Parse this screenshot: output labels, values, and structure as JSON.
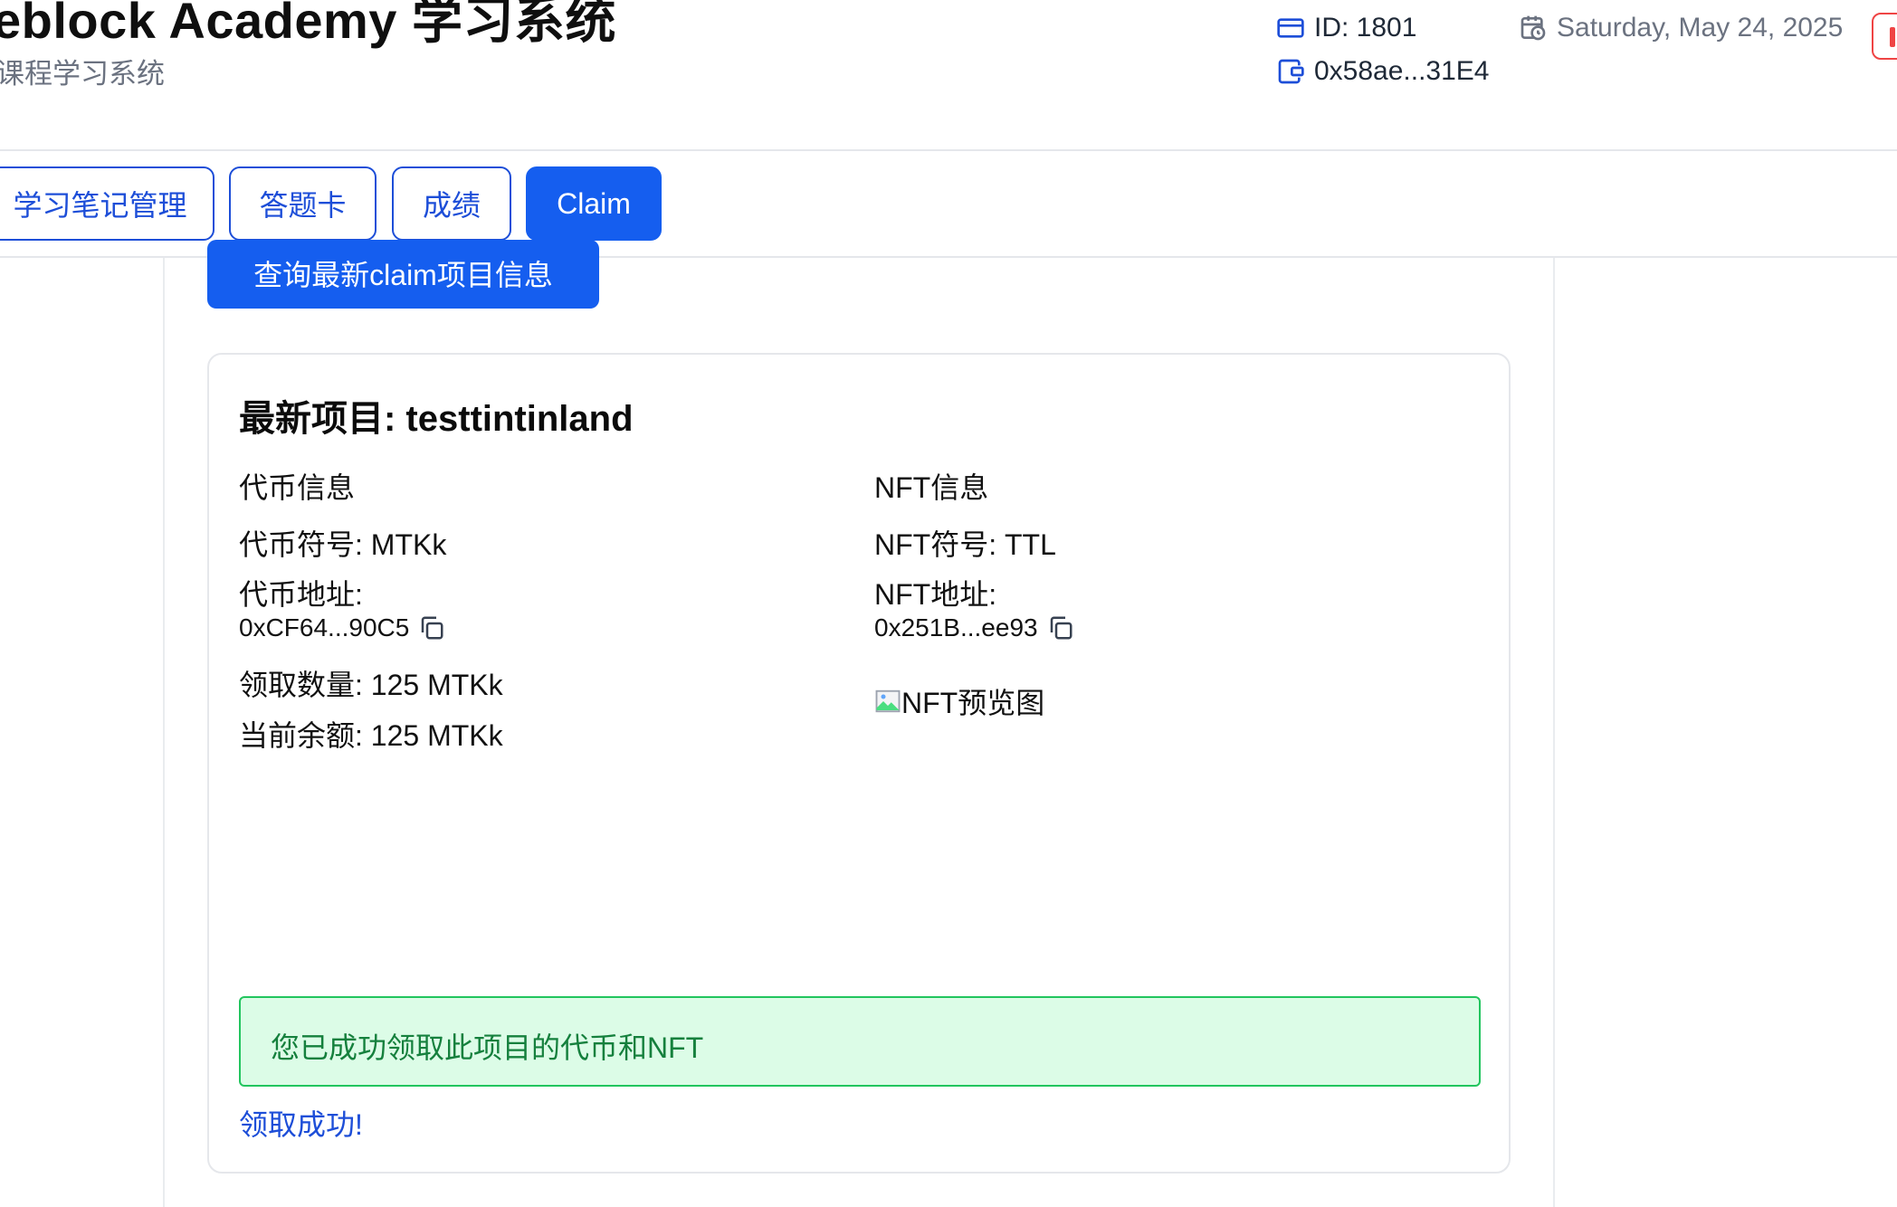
{
  "header": {
    "title": "eblock Academy 学习系统",
    "subtitle": "课程学习系统",
    "user_id": "ID: 1801",
    "wallet": "0x58ae...31E4",
    "date": "Saturday, May 24, 2025"
  },
  "tabs": [
    {
      "label": "学习笔记管理",
      "active": false
    },
    {
      "label": "答题卡",
      "active": false
    },
    {
      "label": "成绩",
      "active": false
    },
    {
      "label": "Claim",
      "active": true
    }
  ],
  "main": {
    "query_button": "查询最新claim项目信息",
    "card": {
      "title": "最新项目: testtintinland",
      "token": {
        "heading": "代币信息",
        "symbol": "代币符号: MTKk",
        "address_label": "代币地址:",
        "address": "0xCF64...90C5",
        "claim_amount": "领取数量: 125 MTKk",
        "balance": "当前余额: 125 MTKk"
      },
      "nft": {
        "heading": "NFT信息",
        "symbol": "NFT符号: TTL",
        "address_label": "NFT地址:",
        "address": "0x251B...ee93",
        "preview_alt": "NFT预览图"
      },
      "success_message": "您已成功领取此项目的代币和NFT",
      "claim_status": "领取成功!"
    }
  },
  "colors": {
    "primary": "#155eef",
    "success_bg": "#dcfce7",
    "success_border": "#22c55e",
    "success_text": "#15803d"
  },
  "icons": {
    "id": "id-card-icon",
    "wallet": "wallet-icon",
    "date": "calendar-clock-icon",
    "copy": "copy-icon",
    "broken_image": "broken-image-icon"
  }
}
